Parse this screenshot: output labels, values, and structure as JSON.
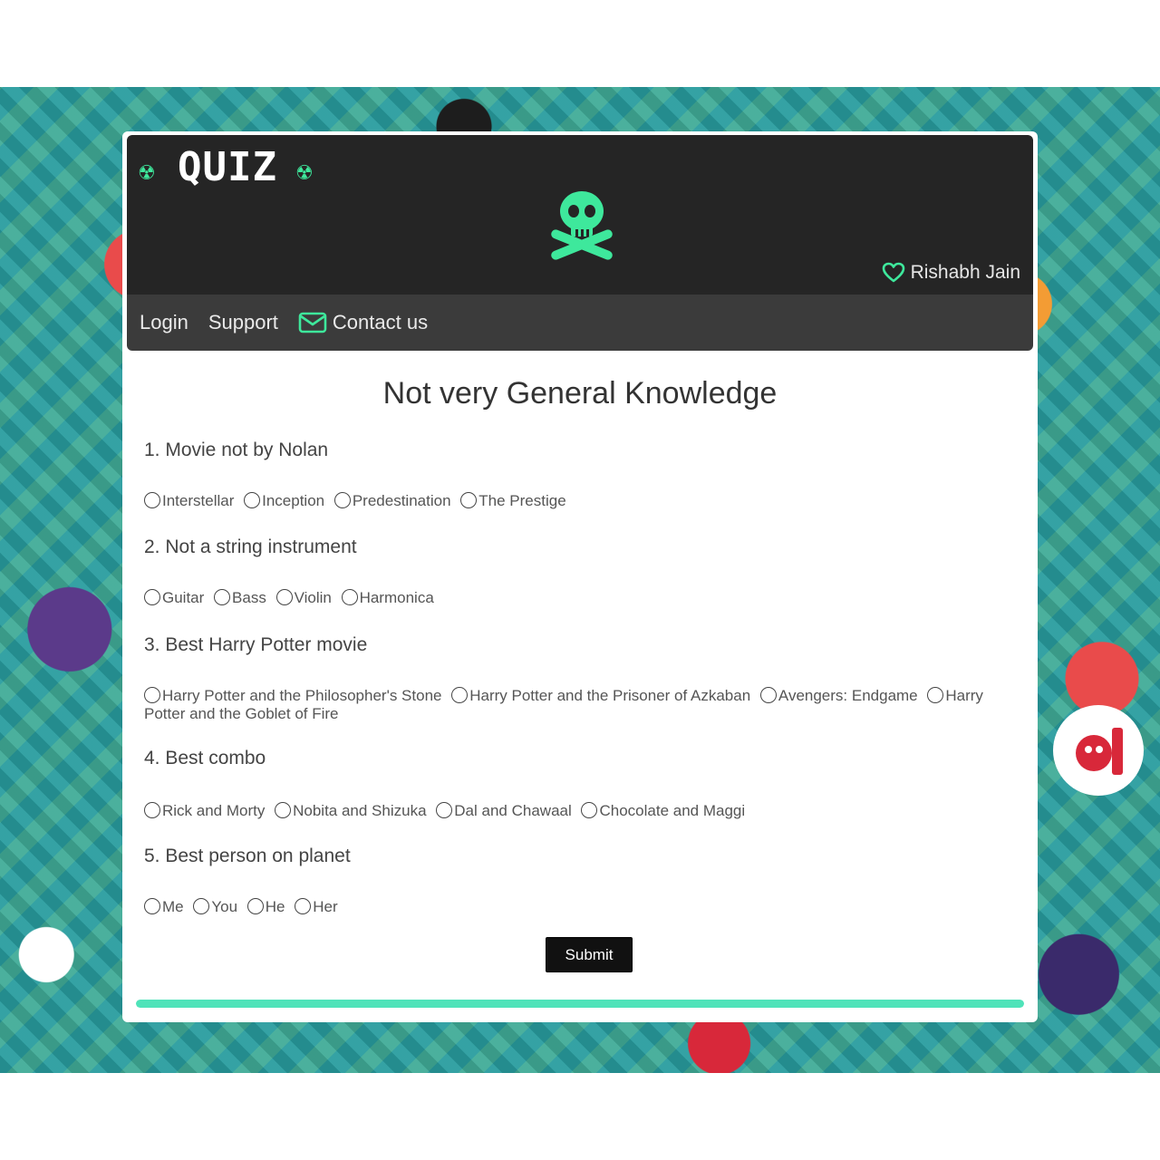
{
  "header": {
    "site_title": "QUIZ",
    "trefoil_symbol": "☢",
    "user_name": "Rishabh Jain",
    "accent_color": "#3ee89c"
  },
  "nav": {
    "items": [
      {
        "label": "Login"
      },
      {
        "label": "Support"
      },
      {
        "label": "Contact us",
        "icon": "envelope-icon"
      }
    ]
  },
  "quiz": {
    "title": "Not very General Knowledge",
    "questions": [
      {
        "text": "1. Movie not by Nolan",
        "options": [
          "Interstellar",
          "Inception",
          "Predestination",
          "The Prestige"
        ]
      },
      {
        "text": "2. Not a string instrument",
        "options": [
          "Guitar",
          "Bass",
          "Violin",
          "Harmonica"
        ]
      },
      {
        "text": "3. Best Harry Potter movie",
        "options": [
          "Harry Potter and the Philosopher's Stone",
          "Harry Potter and the Prisoner of Azkaban",
          "Avengers: Endgame",
          "Harry Potter and the Goblet of Fire"
        ]
      },
      {
        "text": "4. Best combo",
        "options": [
          "Rick and Morty",
          "Nobita and Shizuka",
          "Dal and Chawaal",
          "Chocolate and Maggi"
        ]
      },
      {
        "text": "5. Best person on planet",
        "options": [
          "Me",
          "You",
          "He",
          "Her"
        ]
      }
    ],
    "submit_label": "Submit",
    "progress": 1.0
  },
  "colors": {
    "header_bg": "#252525",
    "nav_bg": "#3b3b3b",
    "progress": "#4fe3b9"
  }
}
